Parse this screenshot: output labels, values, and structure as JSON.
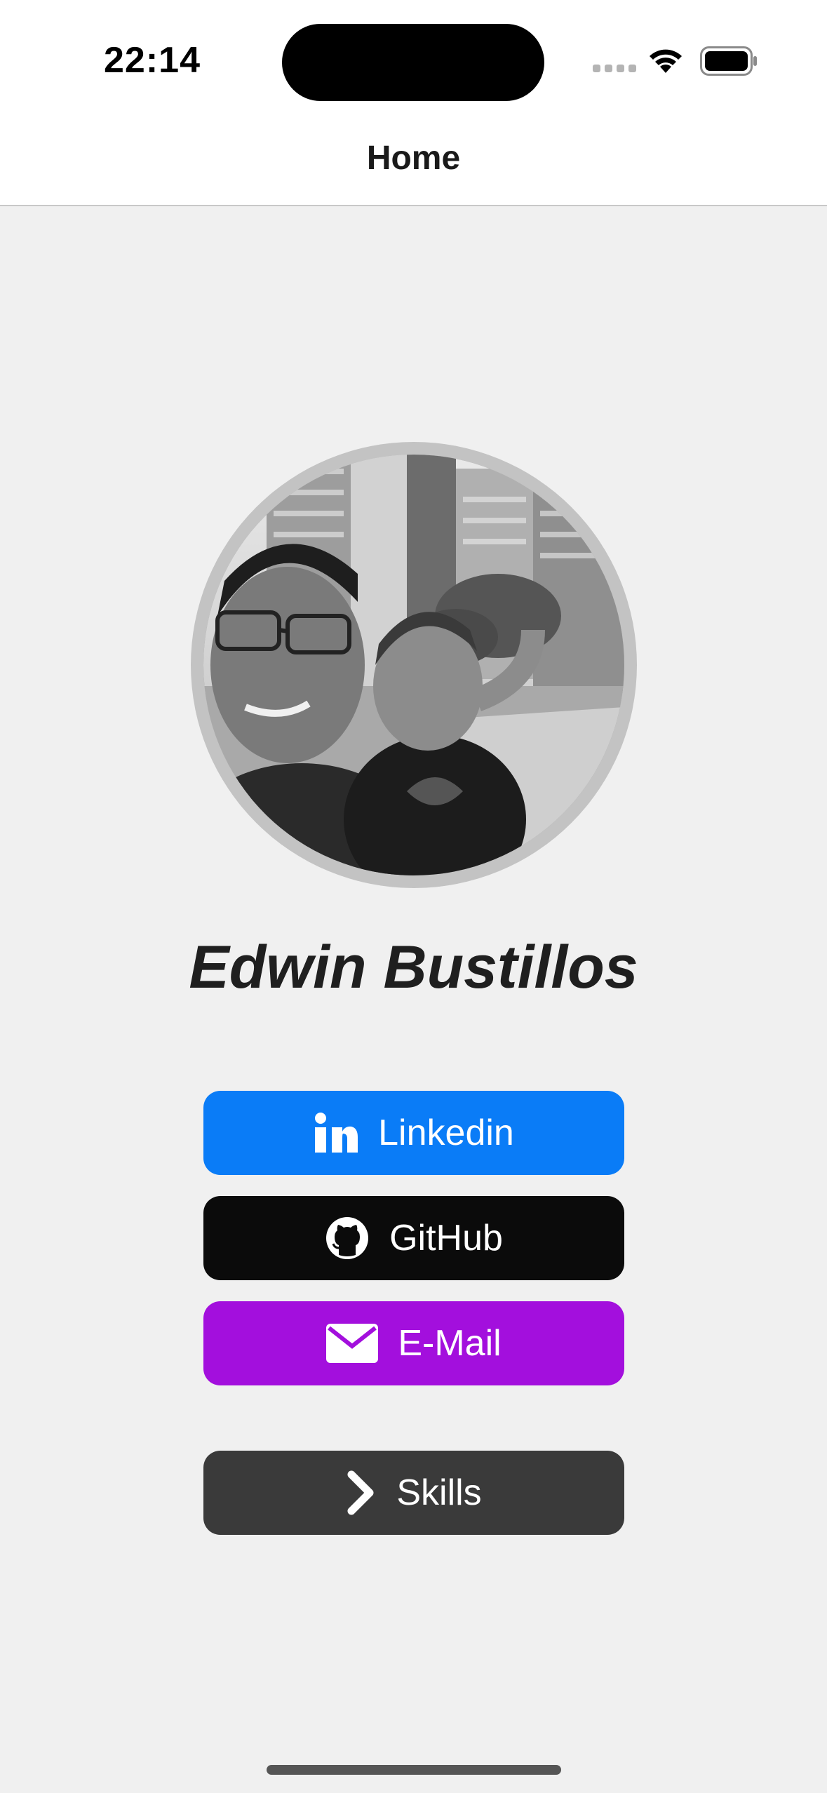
{
  "status_bar": {
    "time": "22:14"
  },
  "nav": {
    "title": "Home"
  },
  "profile": {
    "name": "Edwin Bustillos"
  },
  "links": [
    {
      "label": "Linkedin",
      "icon": "linkedin-icon",
      "color": "#0a7cf7"
    },
    {
      "label": "GitHub",
      "icon": "github-icon",
      "color": "#0b0b0b"
    },
    {
      "label": "E-Mail",
      "icon": "envelope-icon",
      "color": "#a30fdd"
    }
  ],
  "skills_button": {
    "label": "Skills",
    "icon": "chevron-right-icon",
    "color": "#3a3a3a"
  }
}
